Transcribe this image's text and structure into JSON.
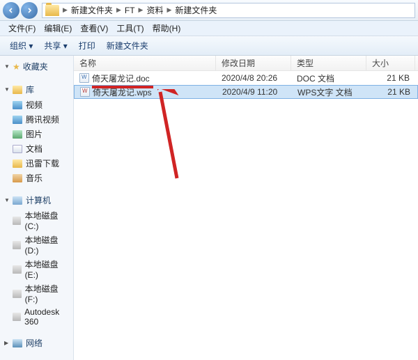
{
  "breadcrumb": {
    "segments": [
      "新建文件夹",
      "FT",
      "资料",
      "新建文件夹"
    ]
  },
  "menu": {
    "file": "文件(F)",
    "edit": "编辑(E)",
    "view": "查看(V)",
    "tools": "工具(T)",
    "help": "帮助(H)"
  },
  "toolbar": {
    "organize": "组织 ▾",
    "share": "共享 ▾",
    "print": "打印",
    "newfolder": "新建文件夹"
  },
  "sidebar": {
    "favorites": "收藏夹",
    "library": "库",
    "library_items": [
      {
        "label": "视频",
        "ico": "ico-video"
      },
      {
        "label": "腾讯视频",
        "ico": "ico-video"
      },
      {
        "label": "图片",
        "ico": "ico-img"
      },
      {
        "label": "文档",
        "ico": "ico-doc"
      },
      {
        "label": "迅雷下载",
        "ico": "ico-folder"
      },
      {
        "label": "音乐",
        "ico": "ico-mus"
      }
    ],
    "computer": "计算机",
    "drives": [
      {
        "label": "本地磁盘 (C:)"
      },
      {
        "label": "本地磁盘 (D:)"
      },
      {
        "label": "本地磁盘 (E:)"
      },
      {
        "label": "本地磁盘 (F:)"
      },
      {
        "label": "Autodesk 360"
      }
    ],
    "network": "网络"
  },
  "columns": {
    "name": "名称",
    "date": "修改日期",
    "type": "类型",
    "size": "大小"
  },
  "files": [
    {
      "name": "倚天屠龙记.doc",
      "date": "2020/4/8 20:26",
      "type": "DOC 文档",
      "size": "21 KB",
      "ico": "doc",
      "selected": false
    },
    {
      "name": "倚天屠龙记.wps",
      "date": "2020/4/9 11:20",
      "type": "WPS文字 文档",
      "size": "21 KB",
      "ico": "wps",
      "selected": true
    }
  ],
  "annotation": {
    "arrow_color": "#d02424"
  }
}
